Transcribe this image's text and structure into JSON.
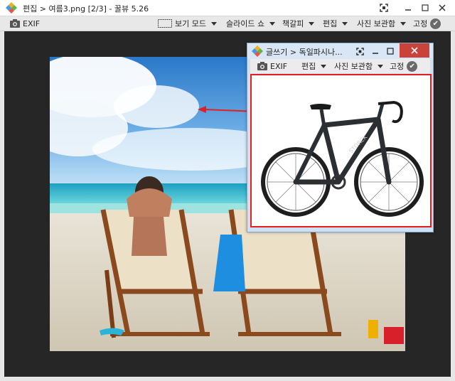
{
  "main": {
    "title": "편집 > 여름3.png [2/3] - 꿀뷰 5.26",
    "toolbar": {
      "exif": "EXIF",
      "view_mode": "보기 모드",
      "slideshow": "슬라이드 쇼",
      "bookmark": "책갈피",
      "edit": "편집",
      "photo_storage": "사진 보관함",
      "pin": "고정"
    }
  },
  "popup": {
    "title": "글쓰기 > 독일파시나...",
    "toolbar": {
      "exif": "EXIF",
      "edit": "편집",
      "photo_storage": "사진 보관함",
      "pin": "고정"
    }
  },
  "colors": {
    "highlight_border": "#e32020",
    "arrow": "#e32020",
    "viewer_bg": "#262626",
    "popup_frame": "#cfe0f2",
    "close_button": "#c9433a"
  }
}
